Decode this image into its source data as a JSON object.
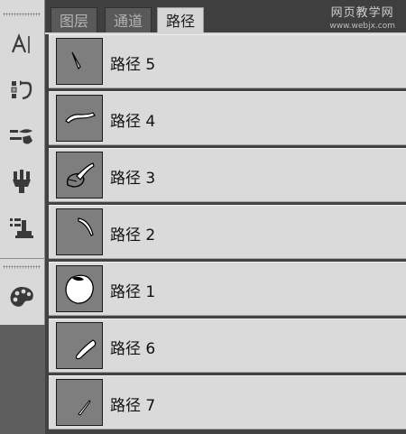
{
  "tabs": [
    {
      "label": "图层",
      "active": false
    },
    {
      "label": "通道",
      "active": false
    },
    {
      "label": "路径",
      "active": true
    }
  ],
  "watermark": {
    "title": "网页教学网",
    "url": "www.webjx.com"
  },
  "tools": [
    {
      "name": "character-tool-icon"
    },
    {
      "name": "paragraph-history-icon"
    },
    {
      "name": "brush-presets-icon"
    },
    {
      "name": "clone-source-icon"
    },
    {
      "name": "tool-presets-icon"
    },
    {
      "name": "swatches-palette-icon"
    }
  ],
  "paths": [
    {
      "label": "路径 5",
      "shape": "stroke-5"
    },
    {
      "label": "路径 4",
      "shape": "stroke-4"
    },
    {
      "label": "路径 3",
      "shape": "stroke-3"
    },
    {
      "label": "路径 2",
      "shape": "stroke-2"
    },
    {
      "label": "路径 1",
      "shape": "stroke-1"
    },
    {
      "label": "路径 6",
      "shape": "stroke-6"
    },
    {
      "label": "路径 7",
      "shape": "stroke-7"
    }
  ],
  "colors": {
    "panel_bg": "#dadada",
    "thumb_bg": "#7e7e7e",
    "dark_bg": "#424242"
  }
}
